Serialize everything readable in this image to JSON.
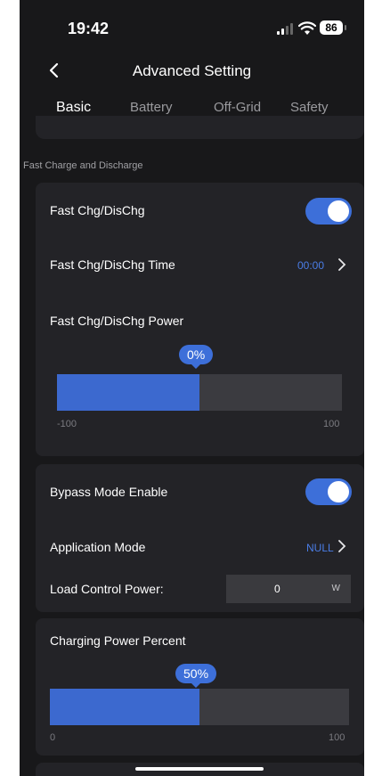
{
  "status_bar": {
    "time": "19:42",
    "battery": "86"
  },
  "header": {
    "title": "Advanced Setting"
  },
  "tabs": [
    {
      "label": "Basic"
    },
    {
      "label": "Battery"
    },
    {
      "label": "Off-Grid"
    },
    {
      "label": "Safety"
    }
  ],
  "section_title": "Fast Charge and Discharge",
  "fast": {
    "toggle_label": "Fast Chg/DisChg",
    "toggle_on": true,
    "time_label": "Fast Chg/DisChg Time",
    "time_value": "00:00",
    "power_label": "Fast Chg/DisChg Power",
    "power_value": "0%",
    "power_level": 0,
    "min_label": "-100",
    "max_label": "100"
  },
  "bypass": {
    "label": "Bypass Mode Enable",
    "toggle_on": true,
    "app_mode_label": "Application Mode",
    "app_mode_value": "NULL",
    "load_label": "Load Control Power:",
    "load_value": "0",
    "load_unit": "W"
  },
  "charging": {
    "label": "Charging Power Percent",
    "value": "50%",
    "level": 50,
    "min_label": "0",
    "max_label": "100"
  },
  "colors": {
    "accent": "#3d6fd9",
    "background": "#18181a",
    "card": "#232327"
  }
}
